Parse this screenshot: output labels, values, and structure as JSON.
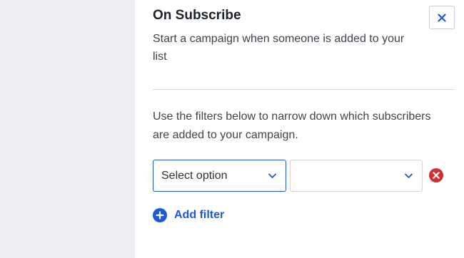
{
  "panel": {
    "title": "On Subscribe",
    "subtitle": "Start a campaign when someone is added to your list",
    "description": "Use the filters below to narrow down which subscribers are added to your campaign."
  },
  "filter_row": {
    "select_1": {
      "value": "Select option"
    },
    "select_2": {
      "value": ""
    }
  },
  "actions": {
    "add_filter_label": "Add filter"
  },
  "icons": {
    "close": "close-icon",
    "chevron": "chevron-down-icon",
    "remove": "remove-filter-icon",
    "add": "plus-circle-icon"
  },
  "colors": {
    "accent": "#1a5ad9",
    "danger": "#d32f2f",
    "sidebar_bg": "#eceef2"
  }
}
